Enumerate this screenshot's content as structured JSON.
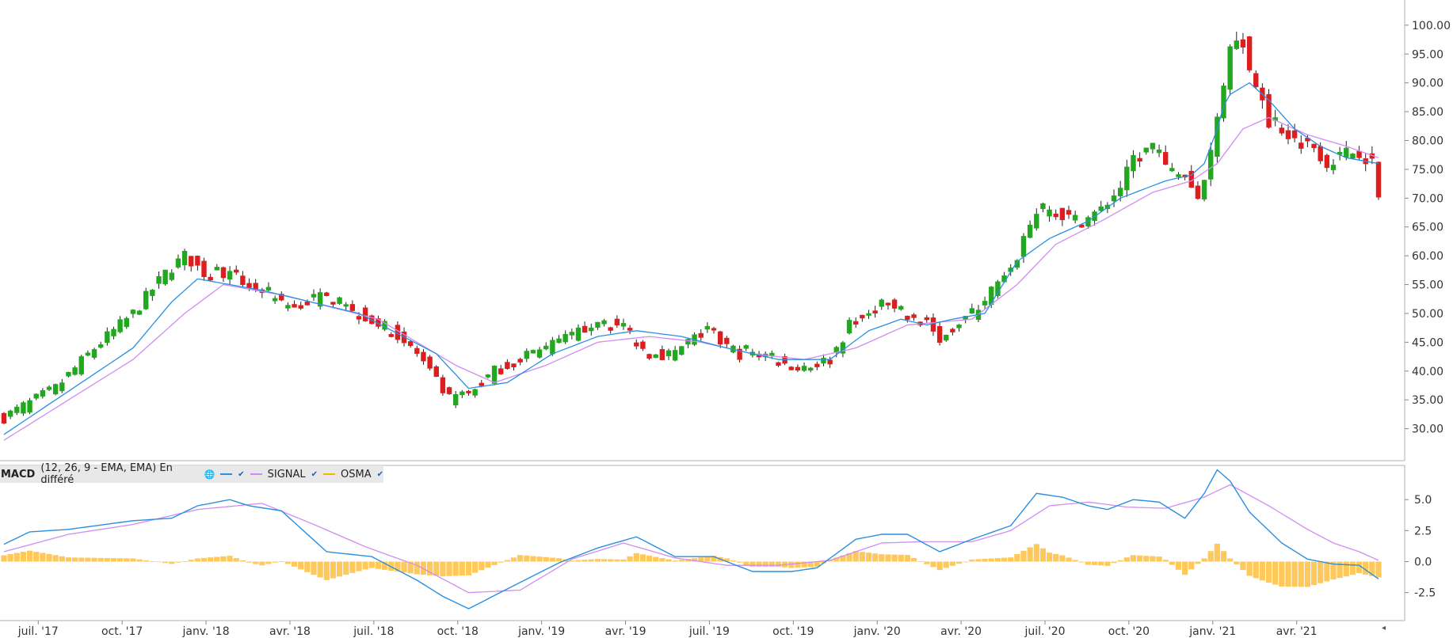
{
  "legend": {
    "name": "MACD",
    "params": "(12, 26, 9 - EMA, EMA) En différé",
    "globe": "🌐",
    "series": [
      {
        "label": "",
        "color": "#2a8fe0"
      },
      {
        "label": "SIGNAL",
        "color": "#cf8df0"
      },
      {
        "label": "OSMA",
        "color": "#f5b800"
      }
    ],
    "check": "✔"
  },
  "end_marker": "◂",
  "colors": {
    "up": "#22a81e",
    "down": "#dd1e1e",
    "ema": "#2a8fe0",
    "signal": "#cf8df0",
    "osma": "#ffc85a",
    "grid": "#b0b0b0"
  },
  "chart_data": [
    {
      "type": "candlestick",
      "y_ticks": [
        "30.00",
        "35.00",
        "40.00",
        "45.00",
        "50.00",
        "55.00",
        "60.00",
        "65.00",
        "70.00",
        "75.00",
        "80.00",
        "85.00",
        "90.00",
        "95.00",
        "100.00"
      ],
      "ylim": [
        25,
        103
      ],
      "x_ticks": [
        {
          "label": "juil. '17",
          "w": 2
        },
        {
          "label": "oct. '17",
          "w": 15
        },
        {
          "label": "janv. '18",
          "w": 28
        },
        {
          "label": "avr. '18",
          "w": 41
        },
        {
          "label": "juil. '18",
          "w": 54
        },
        {
          "label": "oct. '18",
          "w": 67
        },
        {
          "label": "janv. '19",
          "w": 80
        },
        {
          "label": "avr. '19",
          "w": 93
        },
        {
          "label": "juil. '19",
          "w": 106
        },
        {
          "label": "oct. '19",
          "w": 119
        },
        {
          "label": "janv. '20",
          "w": 132
        },
        {
          "label": "avr. '20",
          "w": 145
        },
        {
          "label": "juil. '20",
          "w": 158
        },
        {
          "label": "oct. '20",
          "w": 171
        },
        {
          "label": "janv. '21",
          "w": 184
        },
        {
          "label": "avr. '21",
          "w": 197
        }
      ],
      "anchors": [
        [
          0,
          32
        ],
        [
          8,
          37
        ],
        [
          14,
          44
        ],
        [
          20,
          50
        ],
        [
          25,
          57
        ],
        [
          28,
          60
        ],
        [
          31,
          57
        ],
        [
          34,
          57
        ],
        [
          38,
          55
        ],
        [
          44,
          51
        ],
        [
          50,
          53
        ],
        [
          55,
          50
        ],
        [
          60,
          47
        ],
        [
          64,
          43
        ],
        [
          67,
          38
        ],
        [
          69,
          35
        ],
        [
          72,
          36
        ],
        [
          76,
          40
        ],
        [
          80,
          42
        ],
        [
          84,
          44
        ],
        [
          88,
          46
        ],
        [
          92,
          49
        ],
        [
          95,
          48
        ],
        [
          100,
          43
        ],
        [
          104,
          43
        ],
        [
          106,
          45
        ],
        [
          109,
          47
        ],
        [
          111,
          45
        ],
        [
          114,
          43
        ],
        [
          118,
          43
        ],
        [
          121,
          41
        ],
        [
          125,
          41
        ],
        [
          128,
          42
        ],
        [
          131,
          48
        ],
        [
          134,
          50
        ],
        [
          136,
          52
        ],
        [
          140,
          49
        ],
        [
          143,
          49
        ],
        [
          145,
          45
        ],
        [
          147,
          48
        ],
        [
          150,
          50
        ],
        [
          153,
          54
        ],
        [
          156,
          57
        ],
        [
          158,
          63
        ],
        [
          160,
          68
        ],
        [
          162,
          68
        ],
        [
          164,
          67
        ],
        [
          167,
          66
        ],
        [
          170,
          68
        ],
        [
          173,
          72
        ],
        [
          175,
          77
        ],
        [
          178,
          79
        ],
        [
          180,
          75
        ],
        [
          183,
          74
        ],
        [
          185,
          70
        ],
        [
          187,
          78
        ],
        [
          189,
          90
        ],
        [
          190,
          97
        ],
        [
          192,
          97
        ],
        [
          193,
          92
        ],
        [
          195,
          88
        ],
        [
          196,
          83
        ],
        [
          198,
          82
        ],
        [
          200,
          80
        ],
        [
          203,
          79
        ],
        [
          205,
          76
        ],
        [
          208,
          78
        ],
        [
          210,
          78
        ],
        [
          212,
          76
        ],
        [
          213,
          70
        ]
      ],
      "ema_anchors": [
        [
          0,
          29
        ],
        [
          20,
          44
        ],
        [
          26,
          52
        ],
        [
          30,
          56
        ],
        [
          40,
          54
        ],
        [
          55,
          50
        ],
        [
          67,
          43
        ],
        [
          72,
          37
        ],
        [
          78,
          38
        ],
        [
          85,
          43
        ],
        [
          92,
          46
        ],
        [
          98,
          47
        ],
        [
          105,
          46
        ],
        [
          112,
          44
        ],
        [
          120,
          42
        ],
        [
          128,
          42
        ],
        [
          134,
          47
        ],
        [
          139,
          49
        ],
        [
          143,
          48
        ],
        [
          147,
          49
        ],
        [
          152,
          50
        ],
        [
          157,
          59
        ],
        [
          162,
          63
        ],
        [
          168,
          66
        ],
        [
          173,
          70
        ],
        [
          180,
          73
        ],
        [
          184,
          74
        ],
        [
          186,
          76
        ],
        [
          188,
          82
        ],
        [
          189,
          86
        ],
        [
          190,
          88
        ],
        [
          193,
          90
        ],
        [
          196,
          87
        ],
        [
          200,
          82
        ],
        [
          204,
          79
        ],
        [
          208,
          77
        ],
        [
          213,
          76
        ]
      ],
      "signal_anchors": [
        [
          0,
          28
        ],
        [
          20,
          42
        ],
        [
          28,
          50
        ],
        [
          34,
          55
        ],
        [
          44,
          53
        ],
        [
          58,
          49
        ],
        [
          70,
          41
        ],
        [
          76,
          38
        ],
        [
          84,
          41
        ],
        [
          92,
          45
        ],
        [
          100,
          46
        ],
        [
          108,
          45
        ],
        [
          116,
          43
        ],
        [
          124,
          42
        ],
        [
          132,
          44
        ],
        [
          140,
          48
        ],
        [
          150,
          49
        ],
        [
          157,
          55
        ],
        [
          163,
          62
        ],
        [
          170,
          66
        ],
        [
          178,
          71
        ],
        [
          184,
          73
        ],
        [
          188,
          76
        ],
        [
          192,
          82
        ],
        [
          196,
          84
        ],
        [
          202,
          81
        ],
        [
          208,
          79
        ],
        [
          213,
          77
        ]
      ]
    },
    {
      "type": "line",
      "title": "MACD",
      "y_ticks": [
        "5.0",
        "2.5",
        "0.0",
        "-2.5"
      ],
      "ylim": [
        -4.5,
        7.5
      ],
      "macd_anchors": [
        [
          0,
          1.4
        ],
        [
          4,
          2.4
        ],
        [
          10,
          2.6
        ],
        [
          20,
          3.3
        ],
        [
          26,
          3.5
        ],
        [
          30,
          4.5
        ],
        [
          35,
          5.0
        ],
        [
          38,
          4.5
        ],
        [
          43,
          4.1
        ],
        [
          50,
          0.8
        ],
        [
          57,
          0.4
        ],
        [
          64,
          -1.5
        ],
        [
          68,
          -2.8
        ],
        [
          72,
          -3.8
        ],
        [
          78,
          -2.2
        ],
        [
          86,
          -0.1
        ],
        [
          92,
          1.1
        ],
        [
          98,
          2.0
        ],
        [
          104,
          0.4
        ],
        [
          110,
          0.4
        ],
        [
          116,
          -0.8
        ],
        [
          122,
          -0.8
        ],
        [
          126,
          -0.5
        ],
        [
          132,
          1.8
        ],
        [
          136,
          2.2
        ],
        [
          140,
          2.2
        ],
        [
          145,
          0.8
        ],
        [
          150,
          1.8
        ],
        [
          156,
          2.9
        ],
        [
          160,
          5.5
        ],
        [
          164,
          5.2
        ],
        [
          168,
          4.5
        ],
        [
          171,
          4.2
        ],
        [
          175,
          5.0
        ],
        [
          179,
          4.8
        ],
        [
          183,
          3.5
        ],
        [
          186,
          5.5
        ],
        [
          188,
          7.4
        ],
        [
          190,
          6.5
        ],
        [
          193,
          4.0
        ],
        [
          198,
          1.5
        ],
        [
          202,
          0.2
        ],
        [
          206,
          -0.2
        ],
        [
          210,
          -0.3
        ],
        [
          213,
          -1.4
        ]
      ],
      "signal_anchors": [
        [
          0,
          0.8
        ],
        [
          10,
          2.2
        ],
        [
          20,
          3.0
        ],
        [
          30,
          4.2
        ],
        [
          40,
          4.7
        ],
        [
          48,
          3.0
        ],
        [
          56,
          1.2
        ],
        [
          64,
          -0.3
        ],
        [
          72,
          -2.5
        ],
        [
          80,
          -2.3
        ],
        [
          88,
          0.2
        ],
        [
          96,
          1.5
        ],
        [
          104,
          0.3
        ],
        [
          112,
          -0.3
        ],
        [
          120,
          -0.3
        ],
        [
          128,
          0.1
        ],
        [
          136,
          1.5
        ],
        [
          142,
          1.6
        ],
        [
          150,
          1.6
        ],
        [
          156,
          2.5
        ],
        [
          162,
          4.5
        ],
        [
          168,
          4.8
        ],
        [
          174,
          4.4
        ],
        [
          180,
          4.3
        ],
        [
          186,
          5.2
        ],
        [
          190,
          6.2
        ],
        [
          196,
          4.5
        ],
        [
          202,
          2.6
        ],
        [
          206,
          1.5
        ],
        [
          210,
          0.8
        ],
        [
          213,
          0.1
        ]
      ]
    }
  ]
}
